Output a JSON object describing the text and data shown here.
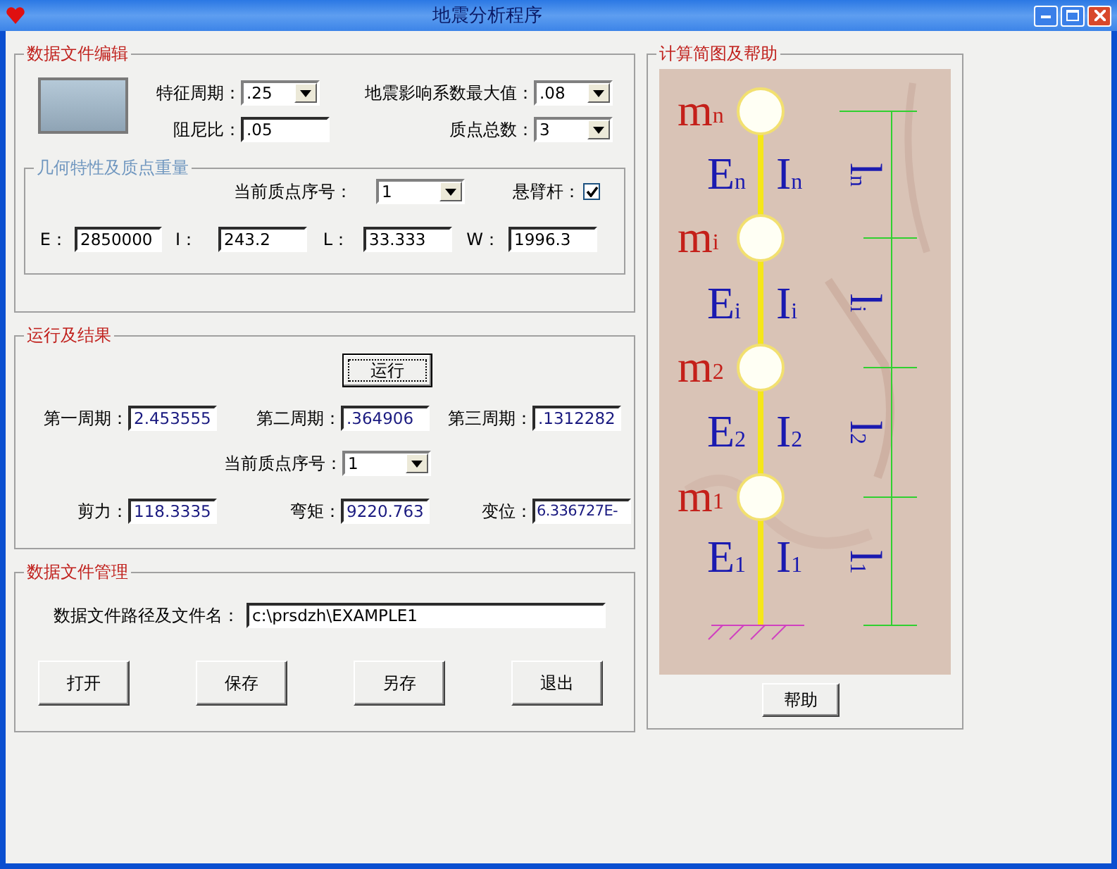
{
  "window": {
    "title": "地震分析程序"
  },
  "data_edit": {
    "title": "数据文件编辑",
    "fields": [
      {
        "label": "特征周期：",
        "value": ".25",
        "kind": "dropdown"
      },
      {
        "label": "地震影响系数最大值：",
        "value": ".08",
        "kind": "dropdown"
      },
      {
        "label": "阻尼比：",
        "value": ".05",
        "kind": "text"
      },
      {
        "label": "质点总数：",
        "value": "3",
        "kind": "dropdown"
      }
    ],
    "geometry": {
      "title": "几何特性及质点重量",
      "disabled": true,
      "current_point": {
        "label": "当前质点序号：",
        "value": "1",
        "kind": "dropdown"
      },
      "cantilever": {
        "label": "悬臂杆：",
        "checked": true
      },
      "fields": [
        {
          "label": "E：",
          "value": "2850000",
          "kind": "text"
        },
        {
          "label": "I：",
          "value": "243.2",
          "kind": "text"
        },
        {
          "label": "L：",
          "value": "33.333",
          "kind": "text"
        },
        {
          "label": "W：",
          "value": "1996.3",
          "kind": "text"
        }
      ]
    }
  },
  "run": {
    "title": "运行及结果",
    "run_button": "运行",
    "periods": [
      {
        "label": "第一周期：",
        "value": "2.453555",
        "kind": "text"
      },
      {
        "label": "第二周期：",
        "value": ".364906",
        "kind": "text"
      },
      {
        "label": "第三周期：",
        "value": ".1312282",
        "kind": "text"
      }
    ],
    "current_point": {
      "label": "当前质点序号：",
      "value": "1",
      "kind": "dropdown"
    },
    "results": [
      {
        "label": "剪力：",
        "value": "118.3335",
        "kind": "text"
      },
      {
        "label": "弯矩：",
        "value": "9220.763",
        "kind": "text"
      },
      {
        "label": "变位：",
        "value": "6.336727E-",
        "kind": "text"
      }
    ]
  },
  "file": {
    "title": "数据文件管理",
    "path": {
      "label": "数据文件路径及文件名：",
      "value": "c:\\prsdzh\\EXAMPLE1",
      "kind": "text"
    },
    "buttons": [
      "打开",
      "保存",
      "另存",
      "退出"
    ]
  },
  "diagram": {
    "title": "计算简图及帮助",
    "masses": [
      {
        "symbol": "m",
        "sub": "n"
      },
      {
        "symbol": "m",
        "sub": "i"
      },
      {
        "symbol": "m",
        "sub": "2"
      },
      {
        "symbol": "m",
        "sub": "1"
      }
    ],
    "sections": [
      {
        "e": "E",
        "e_sub": "n",
        "i": "I",
        "i_sub": "n"
      },
      {
        "e": "E",
        "e_sub": "i",
        "i": "I",
        "i_sub": "i"
      },
      {
        "e": "E",
        "e_sub": "2",
        "i": "I",
        "i_sub": "2"
      },
      {
        "e": "E",
        "e_sub": "1",
        "i": "I",
        "i_sub": "1"
      }
    ],
    "lengths": [
      {
        "symbol": "l",
        "sub": "n"
      },
      {
        "symbol": "l",
        "sub": "i"
      },
      {
        "symbol": "l",
        "sub": "2"
      },
      {
        "symbol": "l",
        "sub": "1"
      }
    ],
    "help_button": "帮助"
  }
}
